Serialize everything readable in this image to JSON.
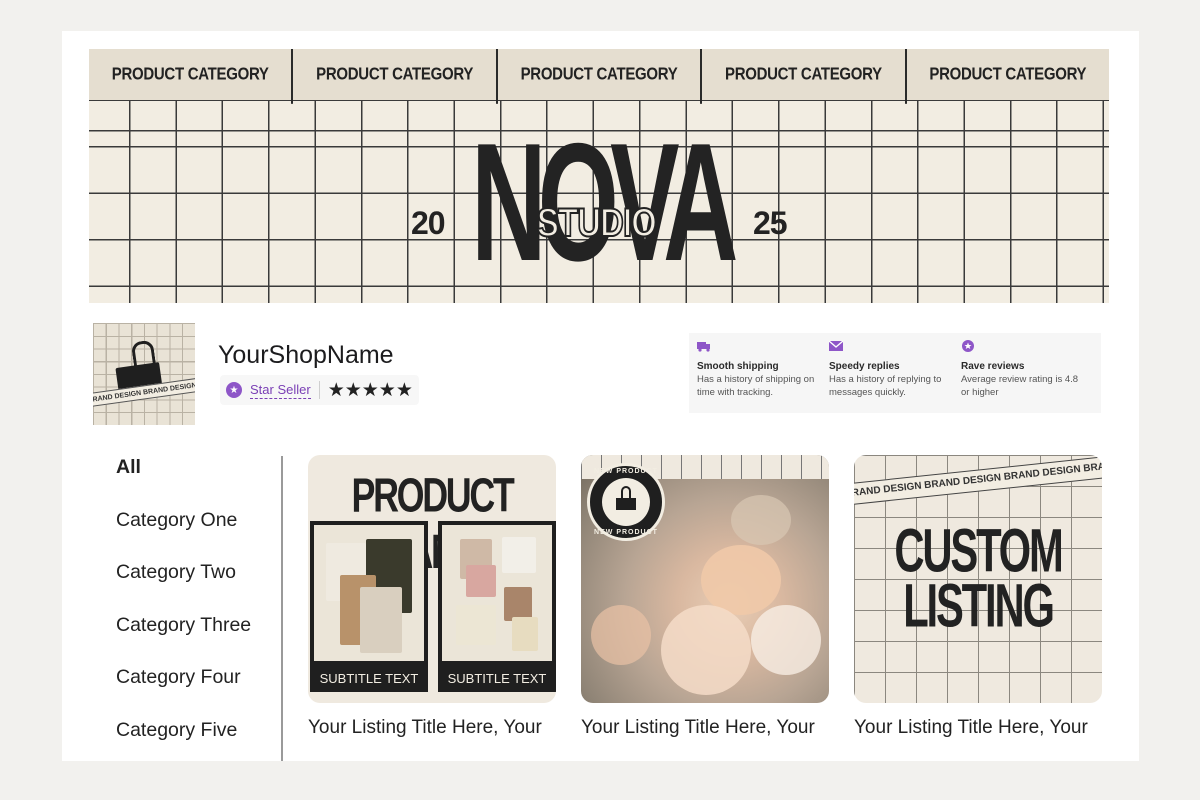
{
  "banner": {
    "categories": [
      "PRODUCT CATEGORY",
      "PRODUCT CATEGORY",
      "PRODUCT CATEGORY",
      "PRODUCT CATEGORY",
      "PRODUCT CATEGORY"
    ],
    "brand_main": "NOVA",
    "brand_sub": "STUDIO",
    "year_left": "20",
    "year_right": "25"
  },
  "shop": {
    "name": "YourShopName",
    "star_seller_label": "Star Seller",
    "rating_stars": 5,
    "stars_text": "★★★★★",
    "logo_strip_text": "BRAND DESIGN BRAND DESIGN BRAND DESIGN"
  },
  "perks": [
    {
      "icon": "truck-icon",
      "title": "Smooth shipping",
      "description": "Has a history of shipping on time with tracking."
    },
    {
      "icon": "envelope-icon",
      "title": "Speedy replies",
      "description": "Has a history of replying to messages quickly."
    },
    {
      "icon": "star-badge-icon",
      "title": "Rave reviews",
      "description": "Average review rating is 4.8 or higher"
    }
  ],
  "sidebar": {
    "items": [
      {
        "label": "All",
        "active": true
      },
      {
        "label": "Category One",
        "active": false
      },
      {
        "label": "Category Two",
        "active": false
      },
      {
        "label": "Category Three",
        "active": false
      },
      {
        "label": "Category Four",
        "active": false
      },
      {
        "label": "Category Five",
        "active": false
      }
    ]
  },
  "listings": [
    {
      "title": "Your Listing Title Here, Your",
      "image": {
        "heading": "PRODUCT NAME",
        "subtitle_left": "SUBTITLE TEXT",
        "subtitle_right": "SUBTITLE TEXT"
      }
    },
    {
      "title": "Your Listing Title Here, Your",
      "image": {
        "badge_top": "NEW PRODUCT",
        "badge_bottom": "NEW PRODUCT"
      }
    },
    {
      "title": "Your Listing Title Here, Your",
      "image": {
        "heading_line1": "CUSTOM",
        "heading_line2": "LISTING",
        "strip_text": "BRAND DESIGN BRAND DESIGN BRAND DESIGN BRAND DESIGN"
      }
    }
  ],
  "colors": {
    "banner_bg": "#f2ede2",
    "category_bar_bg": "#e5ded0",
    "ink": "#232323",
    "star_seller_purple": "#7a3fb5"
  }
}
